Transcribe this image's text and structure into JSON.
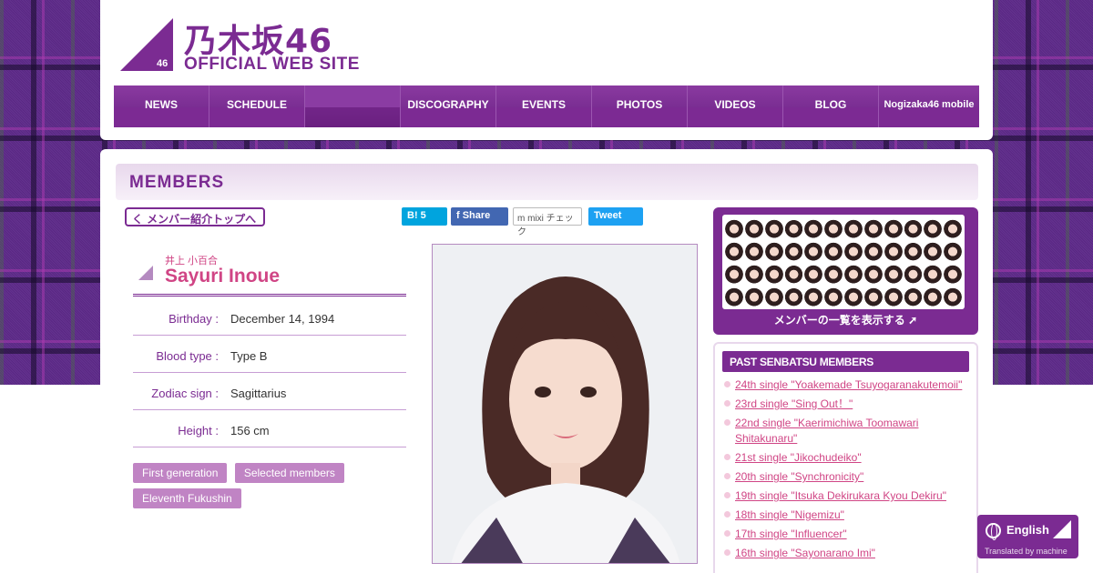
{
  "header": {
    "logo_jp": "乃木坂46",
    "logo_en": "OFFICIAL WEB SITE",
    "logo_badge": "46",
    "nav": [
      "NEWS",
      "SCHEDULE",
      "",
      "DISCOGRAPHY",
      "EVENTS",
      "PHOTOS",
      "VIDEOS",
      "BLOG",
      "Nogizaka46 mobile"
    ]
  },
  "section_title": "MEMBERS",
  "back_button": "く メンバー紹介トップへ",
  "share": {
    "hatena": "B! 5",
    "facebook": "f Share",
    "mixi": "m mixi チェック",
    "twitter": "Tweet"
  },
  "profile": {
    "name_jp": "井上 小百合",
    "name_en": "Sayuri Inoue",
    "fields": [
      {
        "key": "Birthday :",
        "value": "December 14, 1994"
      },
      {
        "key": "Blood type :",
        "value": "Type B"
      },
      {
        "key": "Zodiac sign :",
        "value": "Sagittarius"
      },
      {
        "key": "Height :",
        "value": "156 cm"
      }
    ],
    "tags": [
      "First generation",
      "Selected members",
      "Eleventh Fukushin"
    ]
  },
  "sidebar": {
    "all_members_label": "メンバーの一覧を表示する ➚",
    "past_title": "PAST SENBATSU MEMBERS",
    "past_list": [
      "24th single \"Yoakemade Tsuyogaranakutemoii\"",
      "23rd single \"Sing Out！\"",
      "22nd single \"Kaerimichiwa Toomawari Shitakunaru\"",
      "21st single \"Jikochudeiko\"",
      "20th single \"Synchronicity\"",
      "19th single \"Itsuka Dekirukara Kyou Dekiru\"",
      "18th single \"Nigemizu\"",
      "17th single \"Influencer\"",
      "16th single \"Sayonarano Imi\""
    ]
  },
  "language": {
    "label": "English",
    "badge": "46",
    "note": "Translated by machine"
  },
  "colors": {
    "brand_purple": "#7b2b92",
    "accent_pink": "#d04585"
  }
}
